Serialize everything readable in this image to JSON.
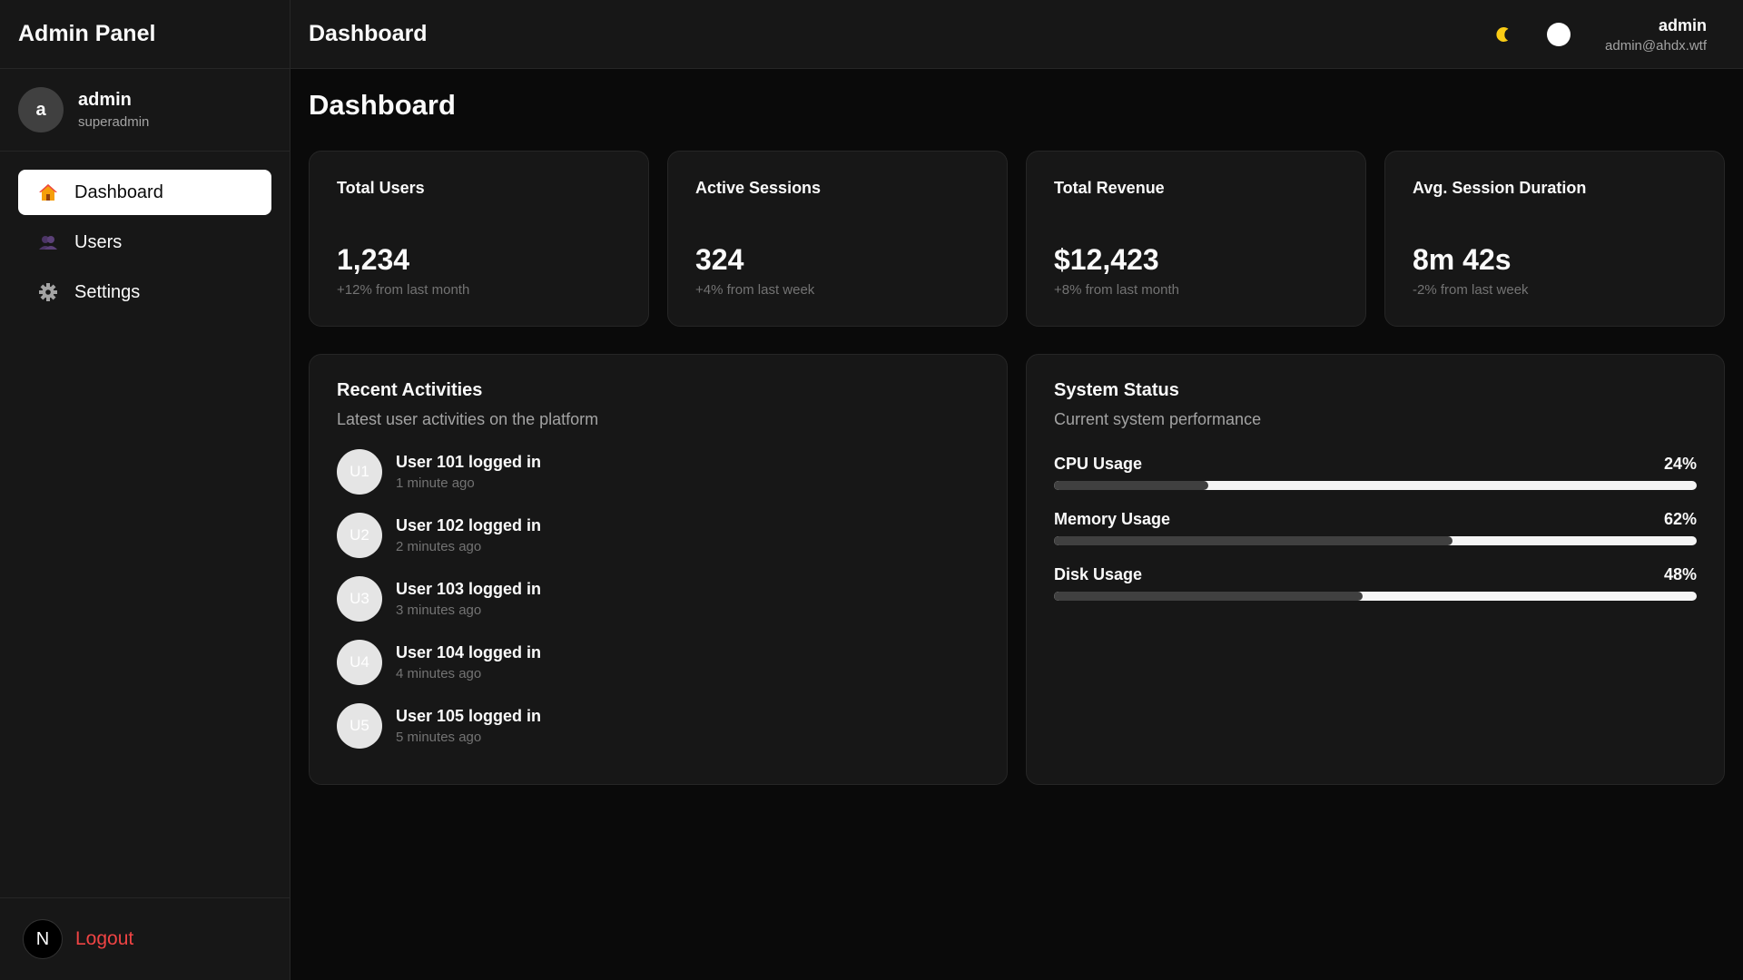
{
  "sidebar": {
    "brand": "Admin Panel",
    "profile": {
      "initial": "a",
      "name": "admin",
      "role": "superadmin"
    },
    "items": [
      {
        "label": "Dashboard",
        "icon": "house-icon",
        "active": true
      },
      {
        "label": "Users",
        "icon": "users-icon",
        "active": false
      },
      {
        "label": "Settings",
        "icon": "gear-icon",
        "active": false
      }
    ],
    "footer": {
      "logo": "N",
      "logout": "Logout"
    }
  },
  "header": {
    "title": "Dashboard",
    "theme_icon": "moon-icon",
    "user_name": "admin",
    "user_email": "admin@ahdx.wtf"
  },
  "main": {
    "title": "Dashboard",
    "stats": [
      {
        "label": "Total Users",
        "value": "1,234",
        "delta": "+12% from last month"
      },
      {
        "label": "Active Sessions",
        "value": "324",
        "delta": "+4% from last week"
      },
      {
        "label": "Total Revenue",
        "value": "$12,423",
        "delta": "+8% from last month"
      },
      {
        "label": "Avg. Session Duration",
        "value": "8m 42s",
        "delta": "-2% from last week"
      }
    ],
    "activities": {
      "title": "Recent Activities",
      "subtitle": "Latest user activities on the platform",
      "items": [
        {
          "avatar": "U1",
          "text": "User 101 logged in",
          "time": "1 minute ago"
        },
        {
          "avatar": "U2",
          "text": "User 102 logged in",
          "time": "2 minutes ago"
        },
        {
          "avatar": "U3",
          "text": "User 103 logged in",
          "time": "3 minutes ago"
        },
        {
          "avatar": "U4",
          "text": "User 104 logged in",
          "time": "4 minutes ago"
        },
        {
          "avatar": "U5",
          "text": "User 105 logged in",
          "time": "5 minutes ago"
        }
      ]
    },
    "system": {
      "title": "System Status",
      "subtitle": "Current system performance",
      "metrics": [
        {
          "label": "CPU Usage",
          "value": "24%",
          "percent": 24
        },
        {
          "label": "Memory Usage",
          "value": "62%",
          "percent": 62
        },
        {
          "label": "Disk Usage",
          "value": "48%",
          "percent": 48
        }
      ]
    }
  }
}
